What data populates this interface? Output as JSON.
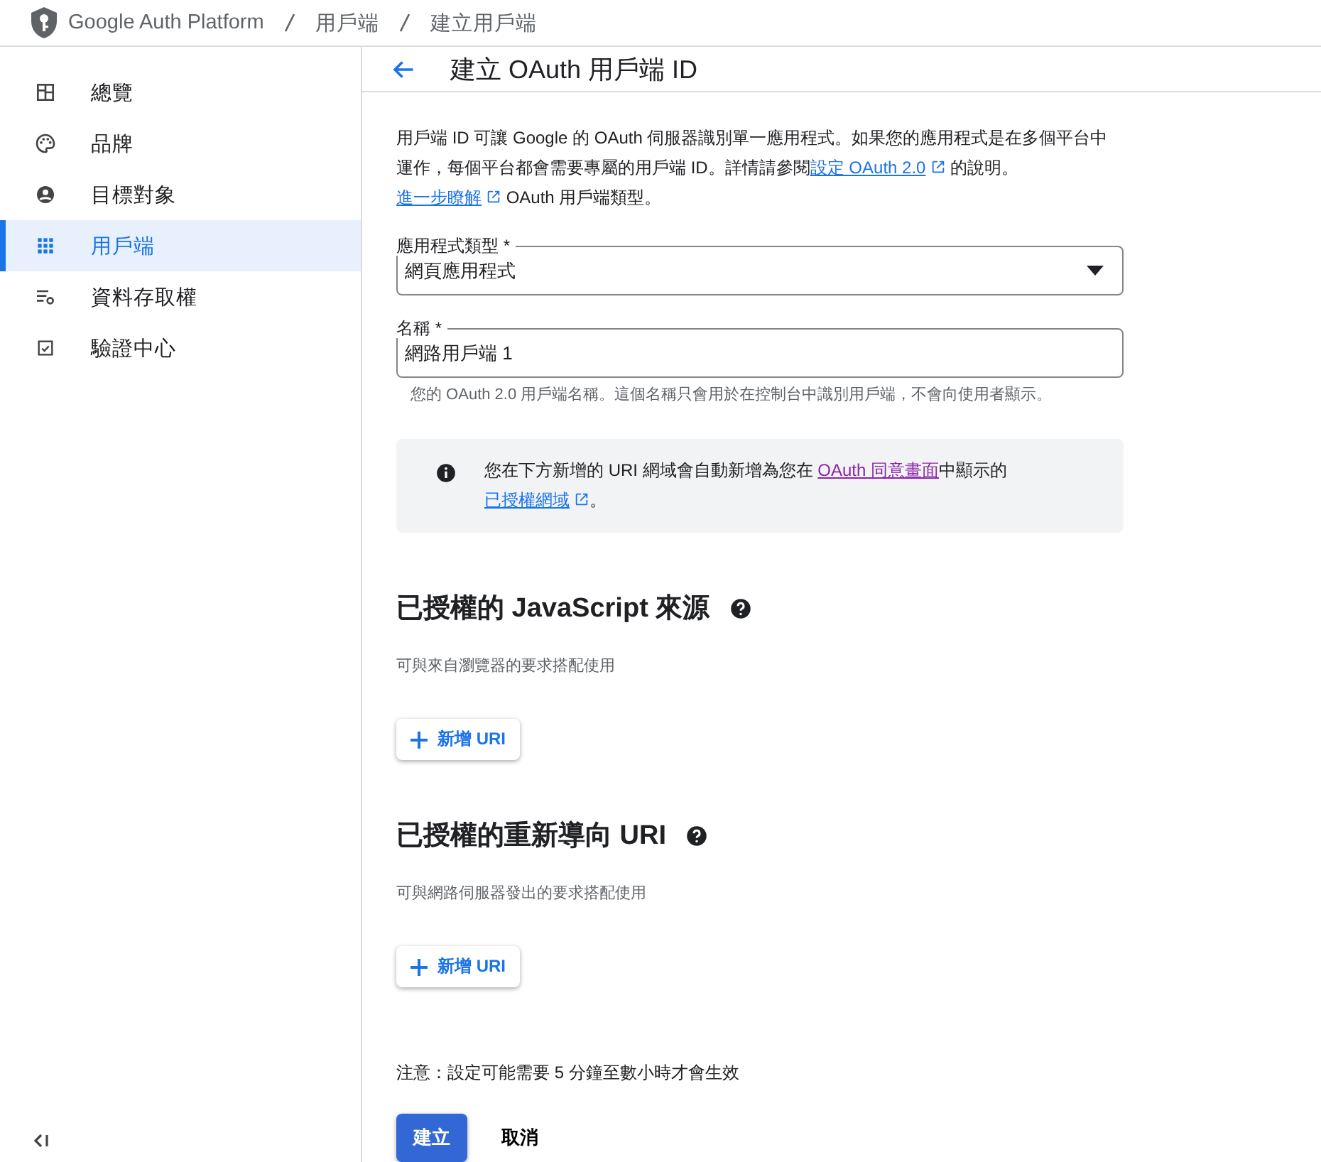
{
  "breadcrumb": [
    "Google Auth Platform",
    "用戶端",
    "建立用戶端"
  ],
  "sidebar": {
    "items": [
      {
        "label": "總覽",
        "selected": false
      },
      {
        "label": "品牌",
        "selected": false
      },
      {
        "label": "目標對象",
        "selected": false
      },
      {
        "label": "用戶端",
        "selected": true
      },
      {
        "label": "資料存取權",
        "selected": false
      },
      {
        "label": "驗證中心",
        "selected": false
      }
    ]
  },
  "page_title": "建立 OAuth 用戶端 ID",
  "intro": [
    {
      "kind": "text",
      "text": "用戶端 ID 可讓 Google 的 OAuth 伺服器識別單一應用程式。如果您的應用程式是在多個平台中運作，每個平台都會需要專屬的用戶端 ID。詳情請參閱"
    },
    {
      "kind": "link",
      "text": "設定 OAuth 2.0",
      "external": true
    },
    {
      "kind": "text",
      "text": " 的說明。"
    },
    {
      "kind": "link",
      "text": "進一步瞭解",
      "external": true
    },
    {
      "kind": "text",
      "text": " OAuth 用戶端類型。"
    }
  ],
  "fields": [
    {
      "kind": "dropdown",
      "label": "應用程式類型 *",
      "value": "網頁應用程式"
    },
    {
      "kind": "text",
      "label": "名稱 *",
      "value": "網路用戶端 1",
      "helper": "您的 OAuth 2.0 用戶端名稱。這個名稱只會用於在控制台中識別用戶端，不會向使用者顯示。"
    }
  ],
  "notice": [
    {
      "kind": "text",
      "text": "您在下方新增的 URI 網域會自動新增為您在 "
    },
    {
      "kind": "visited",
      "text": "OAuth 同意畫面",
      "external": false
    },
    {
      "kind": "text",
      "text": "中顯示的"
    },
    {
      "kind": "link",
      "text": "已授權網域",
      "external": true
    },
    {
      "kind": "text",
      "text": "。"
    }
  ],
  "sections": [
    {
      "title": "已授權的 JavaScript 來源",
      "description": "可與來自瀏覽器的要求搭配使用",
      "button": "新增 URI"
    },
    {
      "title": "已授權的重新導向 URI",
      "description": "可與網路伺服器發出的要求搭配使用",
      "button": "新增 URI"
    }
  ],
  "note": "注意：設定可能需要 5 分鐘至數小時才會生效",
  "actions": [
    {
      "label": "建立",
      "kind": "primary"
    },
    {
      "label": "取消",
      "kind": "text"
    }
  ]
}
